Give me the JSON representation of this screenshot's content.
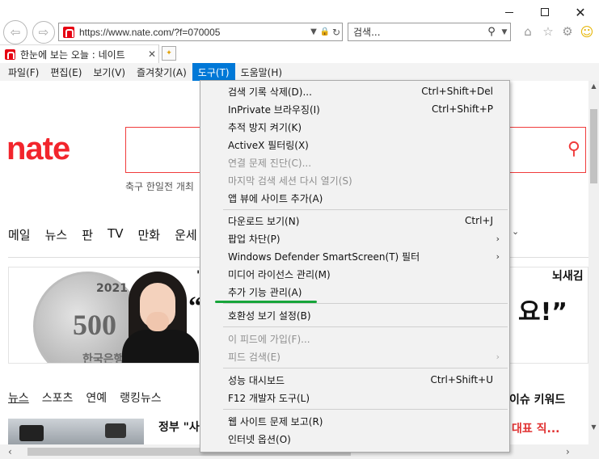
{
  "window": {
    "minimize_icon": "minimize-icon",
    "maximize_icon": "maximize-icon",
    "close_icon": "close-icon"
  },
  "address": {
    "url": "https://www.nate.com/?f=070005"
  },
  "search": {
    "placeholder": "검색..."
  },
  "tab": {
    "title": "한눈에 보는 오늘 : 네이트",
    "close": "✕"
  },
  "menubar": {
    "items": [
      {
        "label": "파일(F)"
      },
      {
        "label": "편집(E)"
      },
      {
        "label": "보기(V)"
      },
      {
        "label": "즐겨찾기(A)"
      },
      {
        "label": "도구(T)"
      },
      {
        "label": "도움말(H)"
      }
    ]
  },
  "page": {
    "logo": "nate",
    "trend_text": "축구 한일전 개최",
    "gnb": [
      "메일",
      "뉴스",
      "판",
      "TV",
      "만화",
      "운세"
    ],
    "banner": {
      "coin_year": "2021",
      "coin_value": "500",
      "coin_text": "한국은행",
      "quote_left": "“",
      "quote_right": "요!”",
      "top_right": "뇌새김",
      "tick": "'"
    },
    "news_tabs": [
      "뉴스",
      "스포츠",
      "연예",
      "랭킹뉴스"
    ],
    "news_headline": "정부 \"사",
    "keyword_label": "이슈 키워드",
    "keyword_item": "대표 직..."
  },
  "tools_menu": {
    "items": [
      {
        "label": "검색 기록 삭제(D)...",
        "shortcut": "Ctrl+Shift+Del",
        "disabled": false
      },
      {
        "label": "InPrivate 브라우징(I)",
        "shortcut": "Ctrl+Shift+P",
        "disabled": false
      },
      {
        "label": "추적 방지 켜기(K)",
        "shortcut": "",
        "disabled": false
      },
      {
        "label": "ActiveX 필터링(X)",
        "shortcut": "",
        "disabled": false
      },
      {
        "label": "연결 문제 진단(C)...",
        "shortcut": "",
        "disabled": true
      },
      {
        "label": "마지막 검색 세션 다시 열기(S)",
        "shortcut": "",
        "disabled": true
      },
      {
        "label": "앱 뷰에 사이트 추가(A)",
        "shortcut": "",
        "disabled": false
      },
      {
        "label": "다운로드 보기(N)",
        "shortcut": "Ctrl+J",
        "disabled": false
      },
      {
        "label": "팝업 차단(P)",
        "shortcut": "",
        "disabled": false,
        "submenu": true
      },
      {
        "label": "Windows Defender SmartScreen(T) 필터",
        "shortcut": "",
        "disabled": false,
        "submenu": true
      },
      {
        "label": "미디어 라이선스 관리(M)",
        "shortcut": "",
        "disabled": false
      },
      {
        "label": "추가 기능 관리(A)",
        "shortcut": "",
        "disabled": false
      },
      {
        "label": "호환성 보기 설정(B)",
        "shortcut": "",
        "disabled": false
      },
      {
        "label": "이 피드에 가입(F)...",
        "shortcut": "",
        "disabled": true
      },
      {
        "label": "피드 검색(E)",
        "shortcut": "",
        "disabled": true,
        "submenu": true
      },
      {
        "label": "성능 대시보드",
        "shortcut": "Ctrl+Shift+U",
        "disabled": false
      },
      {
        "label": "F12 개발자 도구(L)",
        "shortcut": "",
        "disabled": false
      },
      {
        "label": "웹 사이트 문제 보고(R)",
        "shortcut": "",
        "disabled": false
      },
      {
        "label": "인터넷 옵션(O)",
        "shortcut": "",
        "disabled": false
      }
    ]
  },
  "colors": {
    "brand": "#f2252c",
    "menu_active": "#0078d7",
    "highlight_underline": "#17a53a"
  }
}
